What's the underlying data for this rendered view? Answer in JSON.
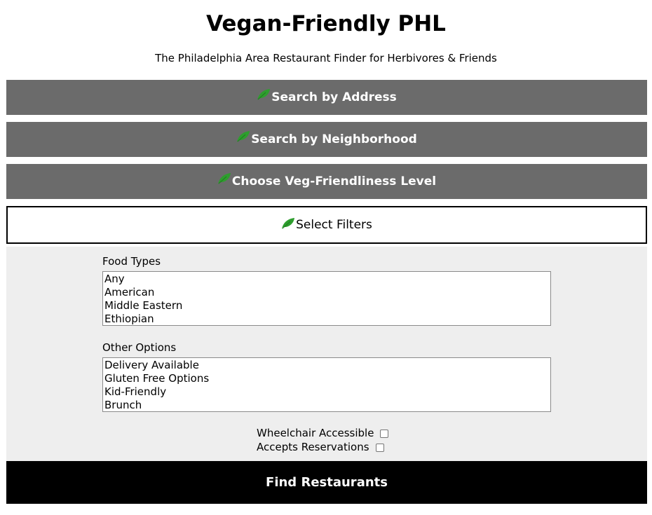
{
  "header": {
    "title": "Vegan-Friendly PHL",
    "subtitle": "The Philadelphia Area Restaurant Finder for Herbivores & Friends"
  },
  "sections": {
    "address": "Search by Address",
    "neighborhood": "Search by Neighborhood",
    "level": "Choose Veg-Friendliness Level",
    "filters": "Select Filters"
  },
  "filters": {
    "food_types": {
      "label": "Food Types",
      "options": [
        "Any",
        "American",
        "Middle Eastern",
        "Ethiopian"
      ]
    },
    "other_options": {
      "label": "Other Options",
      "options": [
        "Delivery Available",
        "Gluten Free Options",
        "Kid-Friendly",
        "Brunch"
      ]
    },
    "wheelchair_label": "Wheelchair Accessible",
    "reservations_label": "Accepts Reservations"
  },
  "submit_label": "Find Restaurants",
  "colors": {
    "bar": "#6b6b6b",
    "leaf": "#2e9e2e",
    "panel": "#eeeeee",
    "button": "#000000"
  },
  "icons": {
    "section": "leaf-icon"
  }
}
